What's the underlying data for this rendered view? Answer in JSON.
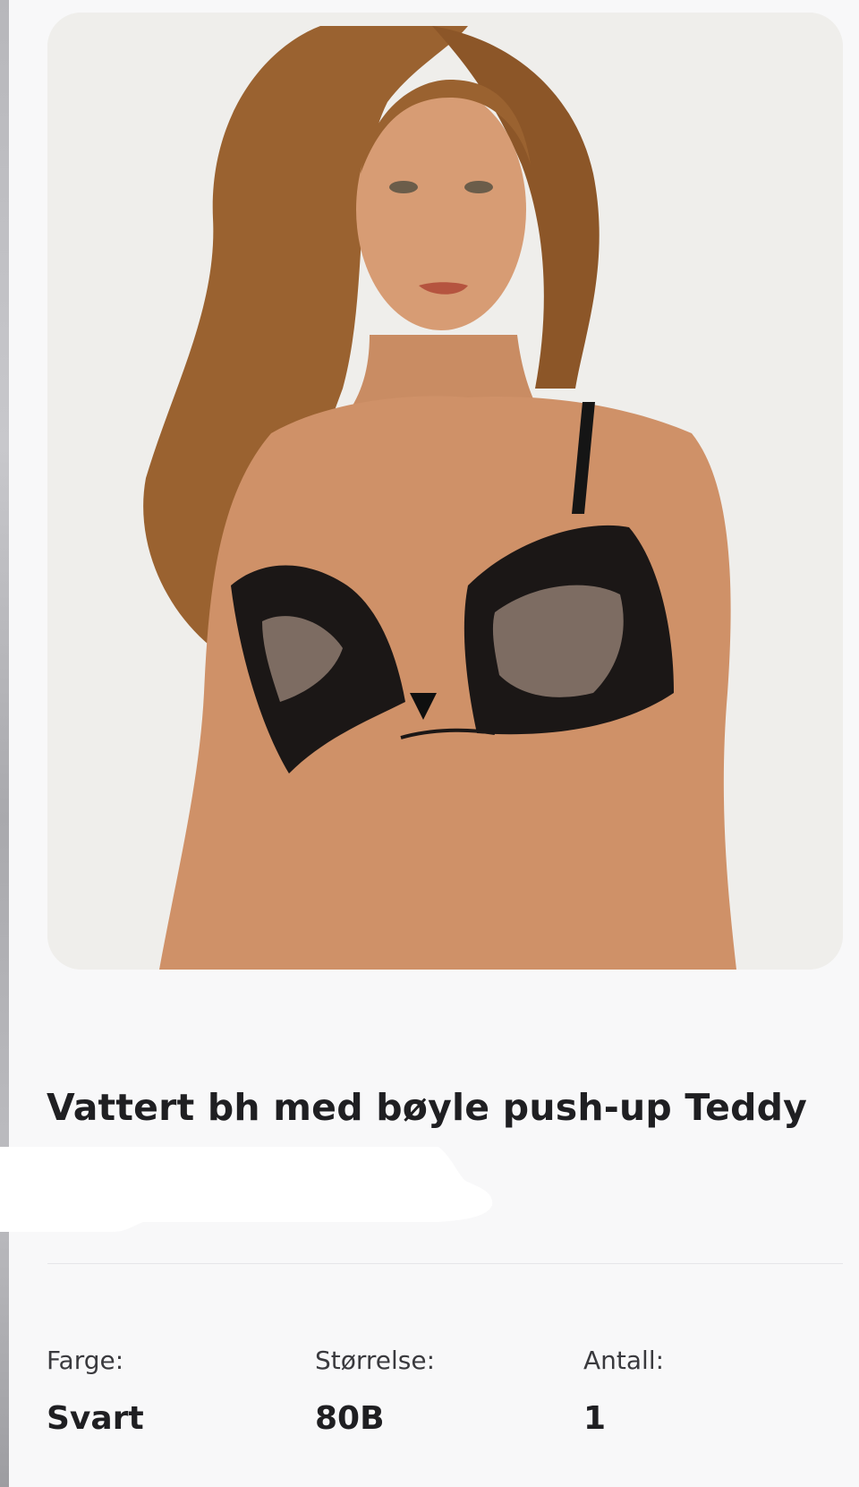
{
  "product": {
    "title": "Vattert bh med bøyle push-up Teddy",
    "image_icon": "product-photo"
  },
  "specs": [
    {
      "label": "Farge:",
      "value": "Svart"
    },
    {
      "label": "Størrelse:",
      "value": "80B"
    },
    {
      "label": "Antall:",
      "value": "1"
    }
  ]
}
